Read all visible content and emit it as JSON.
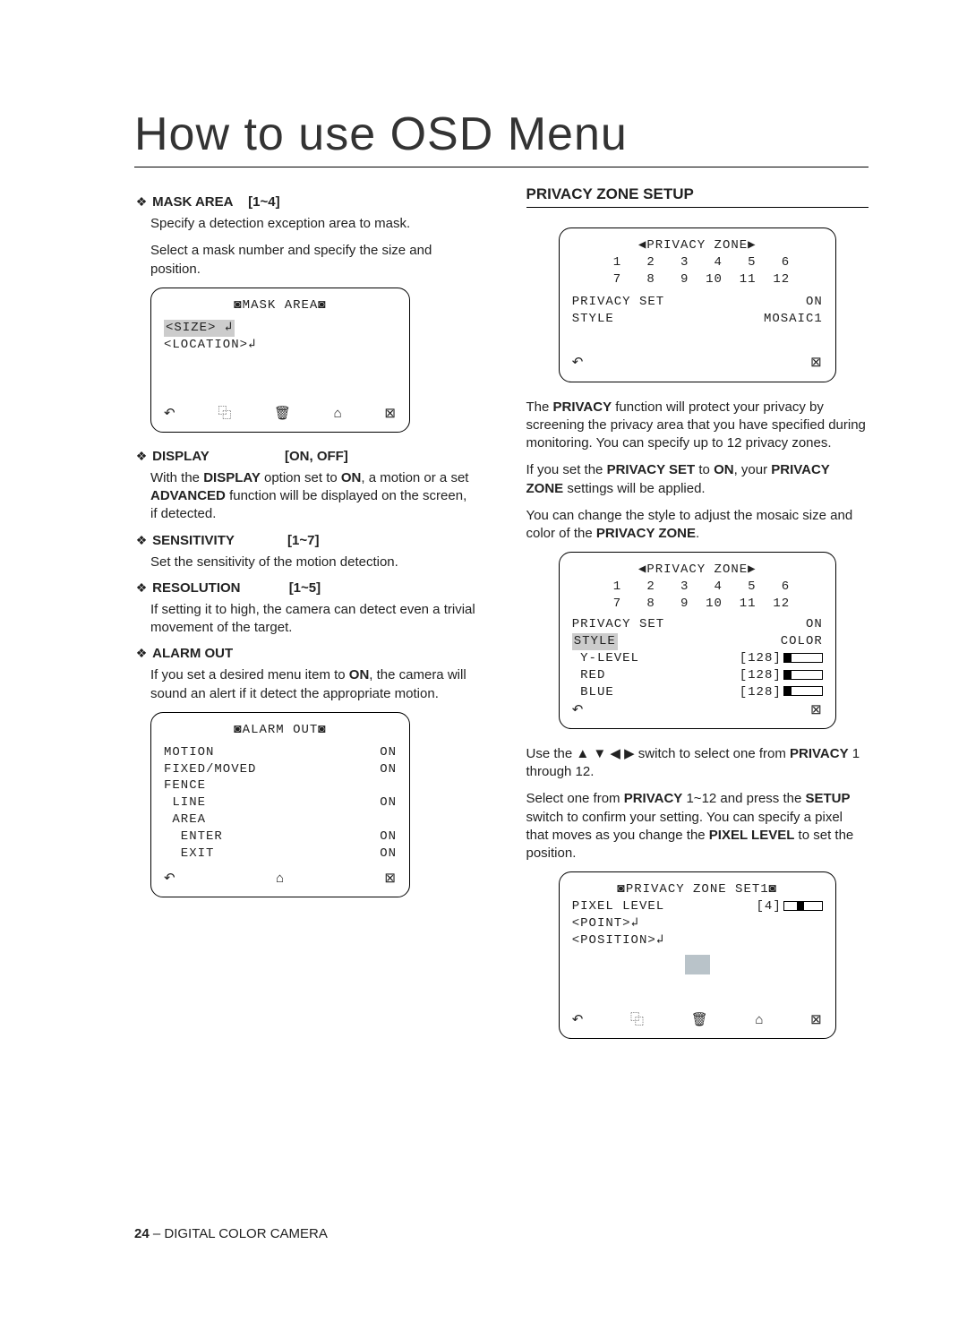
{
  "title": "How to use OSD Menu",
  "footer": {
    "page": "24",
    "label": " – DIGITAL COLOR CAMERA"
  },
  "left": {
    "maskArea": {
      "title": "MASK AREA",
      "range": "[1~4]",
      "p1": "Specify a detection exception area to mask.",
      "p2": "Select a mask number and specify the size and position.",
      "osd": {
        "title": "◙MASK AREA◙",
        "l1": "<SIZE> ↲",
        "l2": "<LOCATION>↲",
        "navBack": "↶",
        "navCopy": "⿻",
        "navDel": "🗑",
        "navHome": "⌂",
        "navClose": "⊠"
      }
    },
    "display": {
      "title": "DISPLAY",
      "range": "[ON, OFF]",
      "p": "With the <b>DISPLAY</b> option set to <b>ON</b>, a motion or a set <b>ADVANCED</b> function will be displayed on the screen, if detected."
    },
    "sensitivity": {
      "title": "SENSITIVITY",
      "range": "[1~7]",
      "p": "Set the sensitivity of the motion detection."
    },
    "resolution": {
      "title": "RESOLUTION",
      "range": "[1~5]",
      "p": "If setting it to high, the camera can detect even a trivial movement of the target."
    },
    "alarmOut": {
      "title": "ALARM OUT",
      "p": "If you set a desired menu item to <b>ON</b>, the camera will sound an alert if it detect the appropriate motion.",
      "osd": {
        "title": "◙ALARM OUT◙",
        "r1a": "MOTION",
        "r1b": "ON",
        "r2a": "FIXED/MOVED",
        "r2b": "ON",
        "r3a": "FENCE",
        "r4a": " LINE",
        "r4b": "ON",
        "r5a": " AREA",
        "r6a": "  ENTER",
        "r6b": "ON",
        "r7a": "  EXIT",
        "r7b": "ON",
        "navBack": "↶",
        "navHome": "⌂",
        "navClose": "⊠"
      }
    }
  },
  "right": {
    "section": "PRIVACY ZONE SETUP",
    "osd1": {
      "title": "◀PRIVACY ZONE▶",
      "nums1": " 1   2   3   4   5   6",
      "nums2": " 7   8   9  10  11  12",
      "r1a": "PRIVACY SET",
      "r1b": "ON",
      "r2a": "STYLE",
      "r2b": "MOSAIC1",
      "navBack": "↶",
      "navClose": "⊠"
    },
    "p1": "The <b>PRIVACY</b> function will protect your privacy by screening the privacy area that you have specified during monitoring. You can specify up to 12 privacy zones.",
    "p2": "If you set the <b>PRIVACY SET</b> to <b>ON</b>, your <b>PRIVACY ZONE</b> settings will be applied.",
    "p3": "You can change the style to adjust the mosaic size and color of the <b>PRIVACY ZONE</b>.",
    "osd2": {
      "title": "◀PRIVACY ZONE▶",
      "nums1": " 1   2   3   4   5   6",
      "nums2": " 7   8   9  10  11  12",
      "r1a": "PRIVACY SET",
      "r1b": "ON",
      "r2a": "STYLE",
      "r2b": "COLOR",
      "r3a": " Y-LEVEL",
      "r3b": "[128]",
      "r4a": " RED",
      "r4b": "[128]",
      "r5a": " BLUE",
      "r5b": "[128]",
      "navBack": "↶",
      "navClose": "⊠"
    },
    "p4": "Use the ▲ ▼ ◀ ▶  switch to select one from <b>PRIVACY</b> 1 through 12.",
    "p5": "Select one from <b>PRIVACY</b> 1~12 and press the <b>SETUP</b> switch to confirm your setting. You can specify a pixel that moves as you change the <b>PIXEL LEVEL</b> to set the position.",
    "osd3": {
      "title": "◙PRIVACY ZONE SET1◙",
      "r1a": "PIXEL LEVEL",
      "r1b": "[4]",
      "r2": "<POINT>↲",
      "r3": "<POSITION>↲",
      "navBack": "↶",
      "navCopy": "⿻",
      "navDel": "🗑",
      "navHome": "⌂",
      "navClose": "⊠"
    }
  }
}
